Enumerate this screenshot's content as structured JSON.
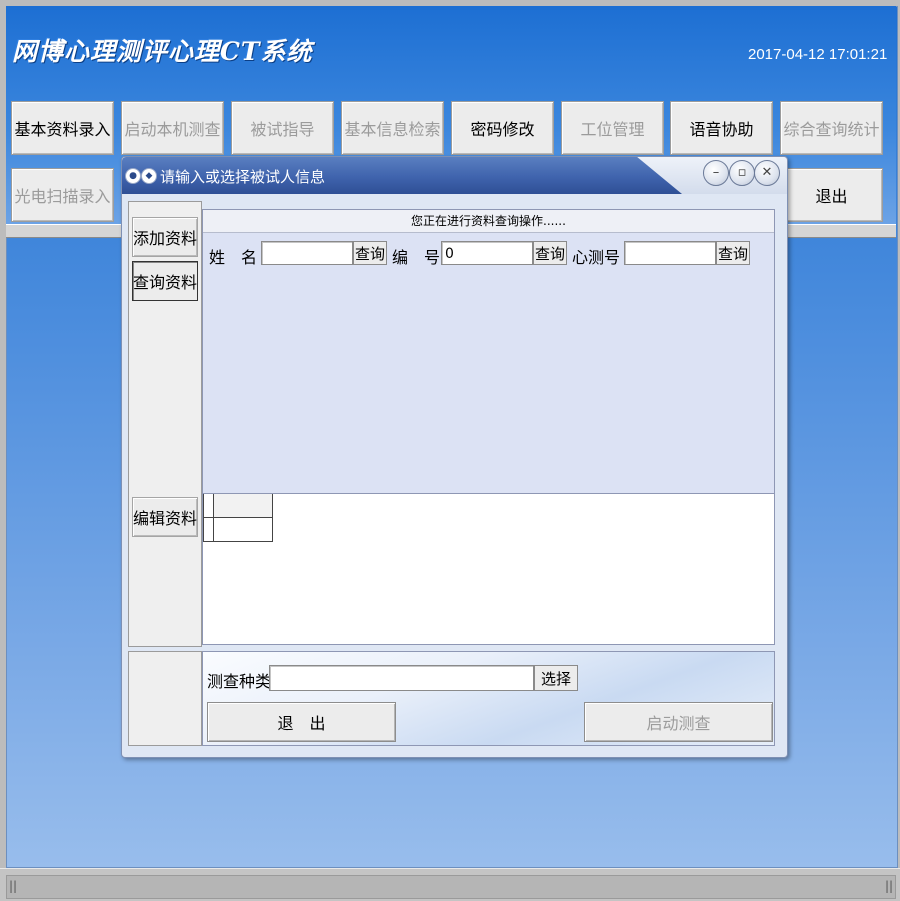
{
  "app": {
    "title": "网博心理测评心理CT系统",
    "datetime": "2017-04-12 17:01:21"
  },
  "toolbar": {
    "row1": [
      {
        "label": "基本资料录入",
        "enabled": true
      },
      {
        "label": "启动本机测查",
        "enabled": false
      },
      {
        "label": "被试指导",
        "enabled": false
      },
      {
        "label": "基本信息检索",
        "enabled": false
      },
      {
        "label": "密码修改",
        "enabled": true
      },
      {
        "label": "工位管理",
        "enabled": false
      },
      {
        "label": "语音协助",
        "enabled": true
      },
      {
        "label": "综合查询统计",
        "enabled": false
      }
    ],
    "row2": [
      {
        "label": "光电扫描录入",
        "enabled": false
      },
      {
        "label": "退出",
        "enabled": true
      }
    ]
  },
  "dialog": {
    "title": "请输入或选择被试人信息",
    "window_controls": [
      "minimize",
      "restore",
      "close"
    ],
    "side_buttons": {
      "add": "添加资料",
      "query": "查询资料",
      "edit": "编辑资料"
    },
    "status_text": "您正在进行资料查询操作......",
    "search": {
      "name_label": "姓　名",
      "name_value": "",
      "id_label": "编　号",
      "id_value": "0",
      "ct_label": "心测号",
      "ct_value": "",
      "query_label": "查询"
    },
    "test_type": {
      "label": "测查种类",
      "value": "",
      "select_label": "选择"
    },
    "exit_label": "退　出",
    "start_label": "启动测查",
    "start_enabled": false
  },
  "colors": {
    "background_top": "#1c6ed2",
    "background_bottom": "#98bdec",
    "dialog_title": "#3f63ad",
    "disabled_text": "#9b9b9b"
  }
}
